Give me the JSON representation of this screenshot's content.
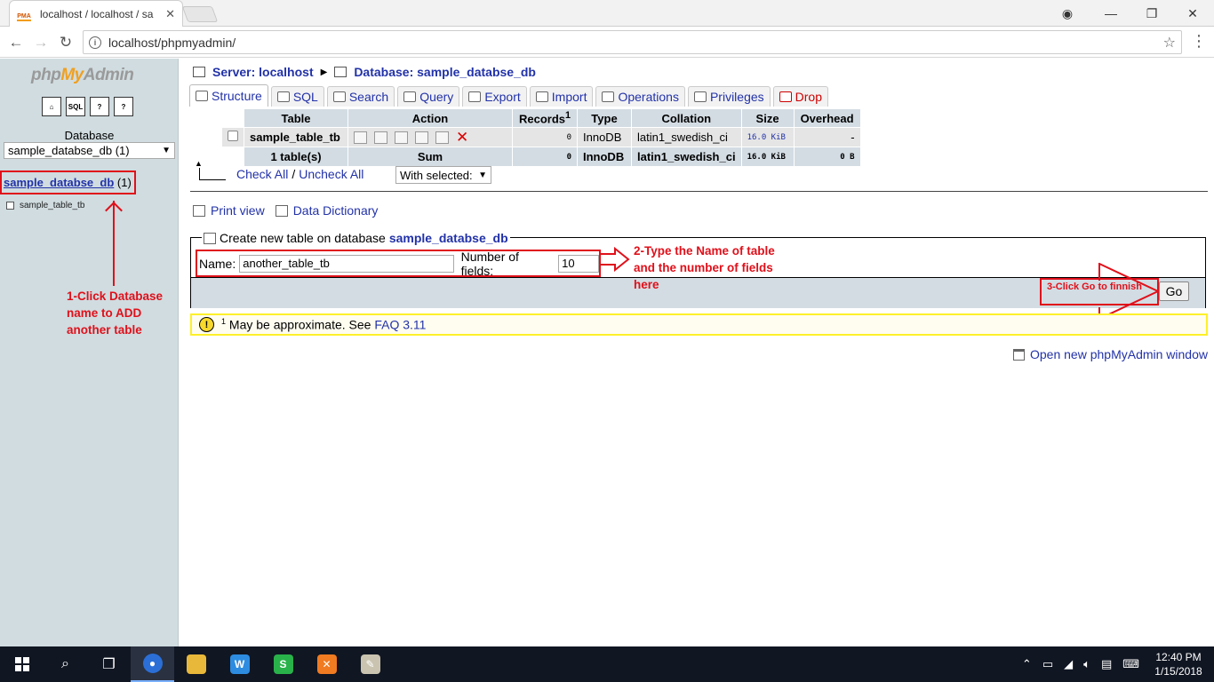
{
  "browser": {
    "tab_title": "localhost / localhost / sa",
    "favicon_text": "PMA",
    "url": "localhost/phpmyadmin/",
    "close_glyph": "✕"
  },
  "left": {
    "logo_php": "php",
    "logo_my": "My",
    "logo_admin": "Admin",
    "db_label": "Database",
    "db_select": "sample_databse_db (1)",
    "db_link_name": "sample_databse_db",
    "db_link_count": "(1)",
    "table_link": "sample_table_tb"
  },
  "crumbs": {
    "server": "Server: localhost",
    "database": "Database: sample_databse_db"
  },
  "tabs": [
    {
      "label": "Structure"
    },
    {
      "label": "SQL"
    },
    {
      "label": "Search"
    },
    {
      "label": "Query"
    },
    {
      "label": "Export"
    },
    {
      "label": "Import"
    },
    {
      "label": "Operations"
    },
    {
      "label": "Privileges"
    },
    {
      "label": "Drop"
    }
  ],
  "table": {
    "headers": {
      "table": "Table",
      "action": "Action",
      "records": "Records",
      "records_sup": "1",
      "type": "Type",
      "collation": "Collation",
      "size": "Size",
      "overhead": "Overhead"
    },
    "row": {
      "name": "sample_table_tb",
      "records": "0",
      "type": "InnoDB",
      "collation": "latin1_swedish_ci",
      "size": "16.0 KiB",
      "overhead": "-"
    },
    "sum": {
      "name": "1 table(s)",
      "label": "Sum",
      "records": "0",
      "type": "InnoDB",
      "collation": "latin1_swedish_ci",
      "size": "16.0 KiB",
      "overhead": "0 B"
    }
  },
  "checks": {
    "check_all": "Check All",
    "slash": "/",
    "uncheck_all": "Uncheck All",
    "with_selected": "With selected:"
  },
  "links": {
    "print_view": "Print view",
    "data_dictionary": "Data Dictionary",
    "new_window": "Open new phpMyAdmin window"
  },
  "create": {
    "legend_prefix": "Create new table on database",
    "legend_db": "sample_databse_db",
    "name_label": "Name:",
    "name_value": "another_table_tb",
    "fields_label": "Number of fields:",
    "fields_value": "10",
    "go_label": "Go"
  },
  "notice": {
    "sup": "1",
    "text": "May be approximate. See",
    "link": "FAQ 3.11"
  },
  "annotations": {
    "a1": "1-Click Database name to ADD another table",
    "a2": "2-Type the Name of table and the number of fields here",
    "a3": "3-Click Go to finnish",
    "color": "#e0101a"
  },
  "taskbar": {
    "time": "12:40 PM",
    "date": "1/15/2018"
  }
}
